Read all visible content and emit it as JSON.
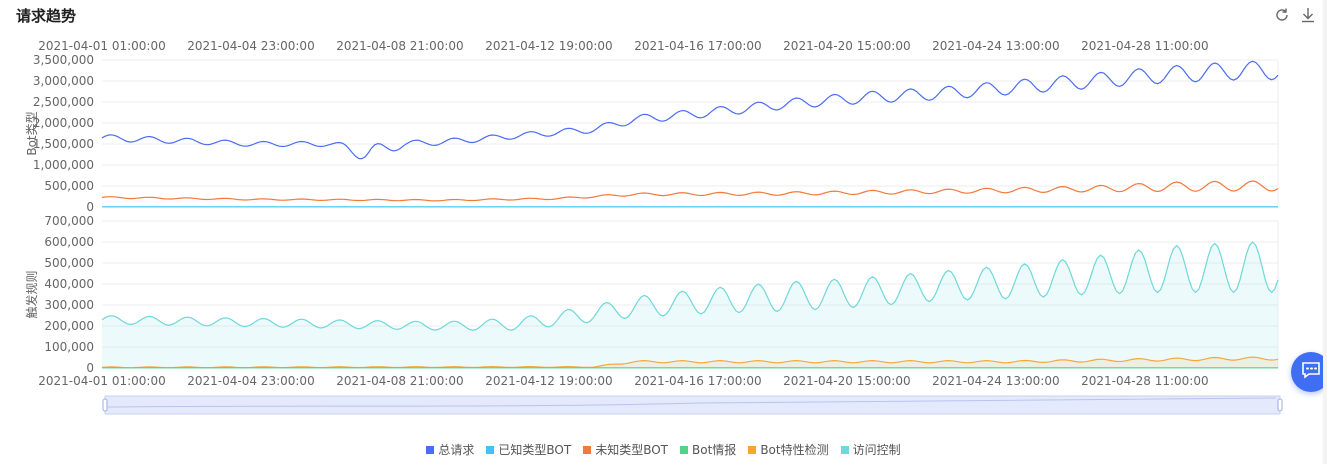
{
  "header": {
    "title": "请求趋势",
    "refresh_icon": "refresh-icon",
    "download_icon": "download-icon"
  },
  "colors": {
    "total": "#4a6cf7",
    "known_bot": "#3dc6f2",
    "unknown_bot": "#f5793b",
    "bot_intel": "#52d38a",
    "bot_feature": "#f7a636",
    "access_control": "#6ed8da"
  },
  "chart_data": [
    {
      "type": "line",
      "ylabel": "Bot类型",
      "ylim": [
        0,
        3500000
      ],
      "y_ticks": [
        "3,500,000",
        "3,000,000",
        "2,500,000",
        "2,000,000",
        "1,500,000",
        "1,000,000",
        "500,000",
        "0"
      ],
      "x_range": [
        "2021-04-01 01:00:00",
        "2021-05-01 23:00:00"
      ],
      "x_ticks": [
        "2021-04-01 01:00:00",
        "2021-04-04 23:00:00",
        "2021-04-08 21:00:00",
        "2021-04-12 19:00:00",
        "2021-04-16 17:00:00",
        "2021-04-20 15:00:00",
        "2021-04-24 13:00:00",
        "2021-04-28 11:00:00"
      ],
      "grid": true,
      "series": [
        {
          "name": "总请求",
          "color_key": "total",
          "x": [
            "2021-04-01",
            "2021-04-03",
            "2021-04-05",
            "2021-04-07",
            "2021-04-08",
            "2021-04-09",
            "2021-04-10",
            "2021-04-11",
            "2021-04-12",
            "2021-04-14",
            "2021-04-15",
            "2021-04-17",
            "2021-04-19",
            "2021-04-21",
            "2021-04-23",
            "2021-04-25",
            "2021-04-27",
            "2021-04-29",
            "2021-05-01"
          ],
          "values": [
            1650000,
            1580000,
            1500000,
            1500000,
            1280000,
            1500000,
            1550000,
            1620000,
            1700000,
            1850000,
            2080000,
            2250000,
            2450000,
            2600000,
            2700000,
            2850000,
            3000000,
            3150000,
            3250000
          ],
          "daily_amplitude": [
            80000,
            70000,
            60000,
            60000,
            200000,
            80000,
            70000,
            70000,
            70000,
            80000,
            100000,
            110000,
            120000,
            140000,
            150000,
            170000,
            180000,
            200000,
            220000
          ]
        },
        {
          "name": "未知类型BOT",
          "color_key": "unknown_bot",
          "x": [
            "2021-04-01",
            "2021-04-05",
            "2021-04-10",
            "2021-04-13",
            "2021-04-15",
            "2021-04-19",
            "2021-04-23",
            "2021-04-27",
            "2021-04-29",
            "2021-05-01"
          ],
          "values": [
            230000,
            180000,
            160000,
            200000,
            300000,
            320000,
            370000,
            430000,
            480000,
            500000
          ],
          "daily_amplitude": [
            20000,
            15000,
            15000,
            20000,
            30000,
            40000,
            50000,
            70000,
            110000,
            120000
          ]
        },
        {
          "name": "已知类型BOT",
          "color_key": "known_bot",
          "x": [
            "2021-04-01",
            "2021-05-01"
          ],
          "values": [
            5000,
            5000
          ],
          "daily_amplitude": [
            0,
            0
          ]
        }
      ]
    },
    {
      "type": "area",
      "ylabel": "触发规则",
      "ylim": [
        0,
        700000
      ],
      "y_ticks": [
        "700,000",
        "600,000",
        "500,000",
        "400,000",
        "300,000",
        "200,000",
        "100,000",
        "0"
      ],
      "x_range": [
        "2021-04-01 01:00:00",
        "2021-05-01 23:00:00"
      ],
      "x_ticks": [
        "2021-04-01 01:00:00",
        "2021-04-04 23:00:00",
        "2021-04-08 21:00:00",
        "2021-04-12 19:00:00",
        "2021-04-16 17:00:00",
        "2021-04-20 15:00:00",
        "2021-04-24 13:00:00",
        "2021-04-28 11:00:00"
      ],
      "grid": true,
      "series": [
        {
          "name": "访问控制",
          "color_key": "access_control",
          "x": [
            "2021-04-01",
            "2021-04-04",
            "2021-04-07",
            "2021-04-10",
            "2021-04-12",
            "2021-04-14",
            "2021-04-15",
            "2021-04-17",
            "2021-04-19",
            "2021-04-21",
            "2021-04-23",
            "2021-04-25",
            "2021-04-27",
            "2021-04-29",
            "2021-05-01"
          ],
          "values": [
            230000,
            220000,
            210000,
            200000,
            210000,
            260000,
            290000,
            320000,
            340000,
            360000,
            390000,
            410000,
            440000,
            470000,
            480000
          ],
          "daily_amplitude": [
            20000,
            20000,
            20000,
            20000,
            30000,
            40000,
            50000,
            60000,
            70000,
            70000,
            70000,
            80000,
            90000,
            110000,
            120000
          ]
        },
        {
          "name": "Bot特性检测",
          "color_key": "bot_feature",
          "x": [
            "2021-04-01",
            "2021-04-14",
            "2021-04-15",
            "2021-04-25",
            "2021-04-27",
            "2021-05-01"
          ],
          "values": [
            3000,
            5000,
            30000,
            30000,
            35000,
            45000
          ],
          "daily_amplitude": [
            2000,
            2000,
            5000,
            5000,
            6000,
            7000
          ]
        },
        {
          "name": "Bot情报",
          "color_key": "bot_intel",
          "x": [
            "2021-04-01",
            "2021-05-01"
          ],
          "values": [
            1000,
            1000
          ],
          "daily_amplitude": [
            0,
            0
          ]
        }
      ]
    }
  ],
  "legend": [
    {
      "label": "总请求",
      "color_key": "total"
    },
    {
      "label": "已知类型BOT",
      "color_key": "known_bot"
    },
    {
      "label": "未知类型BOT",
      "color_key": "unknown_bot"
    },
    {
      "label": "Bot情报",
      "color_key": "bot_intel"
    },
    {
      "label": "Bot特性检测",
      "color_key": "bot_feature"
    },
    {
      "label": "访问控制",
      "color_key": "access_control"
    }
  ],
  "chat_button": {
    "icon": "chat-icon"
  }
}
